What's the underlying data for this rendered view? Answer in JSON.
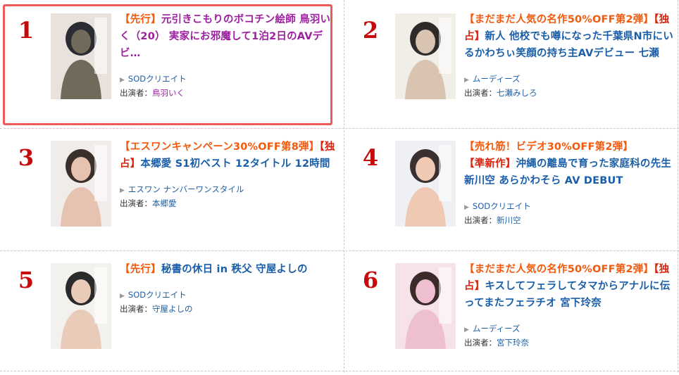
{
  "cast_label": "出演者：",
  "items": [
    {
      "rank": "1",
      "tags": [
        {
          "text": "【先行】"
        }
      ],
      "title_text": "元引きこもりのボコチン絵師 鳥羽いく（20） 実家にお邪魔して1泊2日のAVデビ…",
      "maker": "SODクリエイト",
      "cast": "鳥羽いく",
      "visited": true,
      "selected": true,
      "thumb_colors": [
        "#e9e2dc",
        "#2b2b33",
        "#6f6a5a"
      ]
    },
    {
      "rank": "2",
      "tags": [
        {
          "text": "【まだまだ人気の名作50%OFF第2弾】"
        },
        {
          "text": "【独占】"
        }
      ],
      "title_text": "新人 他校でも噂になった千葉県N市にいるかわちぃ笑顔の持ち主AVデビュー 七瀬み…",
      "maker": "ムーディーズ",
      "cast": "七瀬みしろ",
      "visited": false,
      "selected": false,
      "thumb_colors": [
        "#f1eee8",
        "#2e2a2a",
        "#d9c3b1"
      ]
    },
    {
      "rank": "3",
      "tags": [
        {
          "text": "【エスワンキャンペーン30%OFF第8弾】"
        },
        {
          "text": "【独占】"
        }
      ],
      "title_text": "本郷愛 S1初ベスト 12タイトル 12時間",
      "maker": "エスワン ナンバーワンスタイル",
      "cast": "本郷愛",
      "visited": false,
      "selected": false,
      "thumb_colors": [
        "#f0ecea",
        "#3a2f2b",
        "#e6c2b0"
      ]
    },
    {
      "rank": "4",
      "tags": [
        {
          "text": "【売れ筋！ビデオ30%OFF第2弾】"
        },
        {
          "text": "【準新作】"
        }
      ],
      "title_text": "沖縄の離島で育った家庭科の先生 新川空 あらかわそら AV DEBUT",
      "maker": "SODクリエイト",
      "cast": "新川空",
      "visited": false,
      "selected": false,
      "thumb_colors": [
        "#eef0f3",
        "#3b3030",
        "#f0c9b5"
      ]
    },
    {
      "rank": "5",
      "tags": [
        {
          "text": "【先行】"
        }
      ],
      "title_text": "秘書の休日 in 秩父 守屋よしの",
      "maker": "SODクリエイト",
      "cast": "守屋よしの",
      "visited": false,
      "selected": false,
      "thumb_colors": [
        "#f3f1ee",
        "#2a2a2a",
        "#e8cbb9"
      ]
    },
    {
      "rank": "6",
      "tags": [
        {
          "text": "【まだまだ人気の名作50%OFF第2弾】"
        },
        {
          "text": "【独占】"
        }
      ],
      "title_text": "キスしてフェラしてタマからアナルに伝ってまたフェラチオ 宮下玲奈",
      "maker": "ムーディーズ",
      "cast": "宮下玲奈",
      "visited": false,
      "selected": false,
      "thumb_colors": [
        "#f6e3ea",
        "#3a2a2a",
        "#eebfd0"
      ]
    }
  ]
}
